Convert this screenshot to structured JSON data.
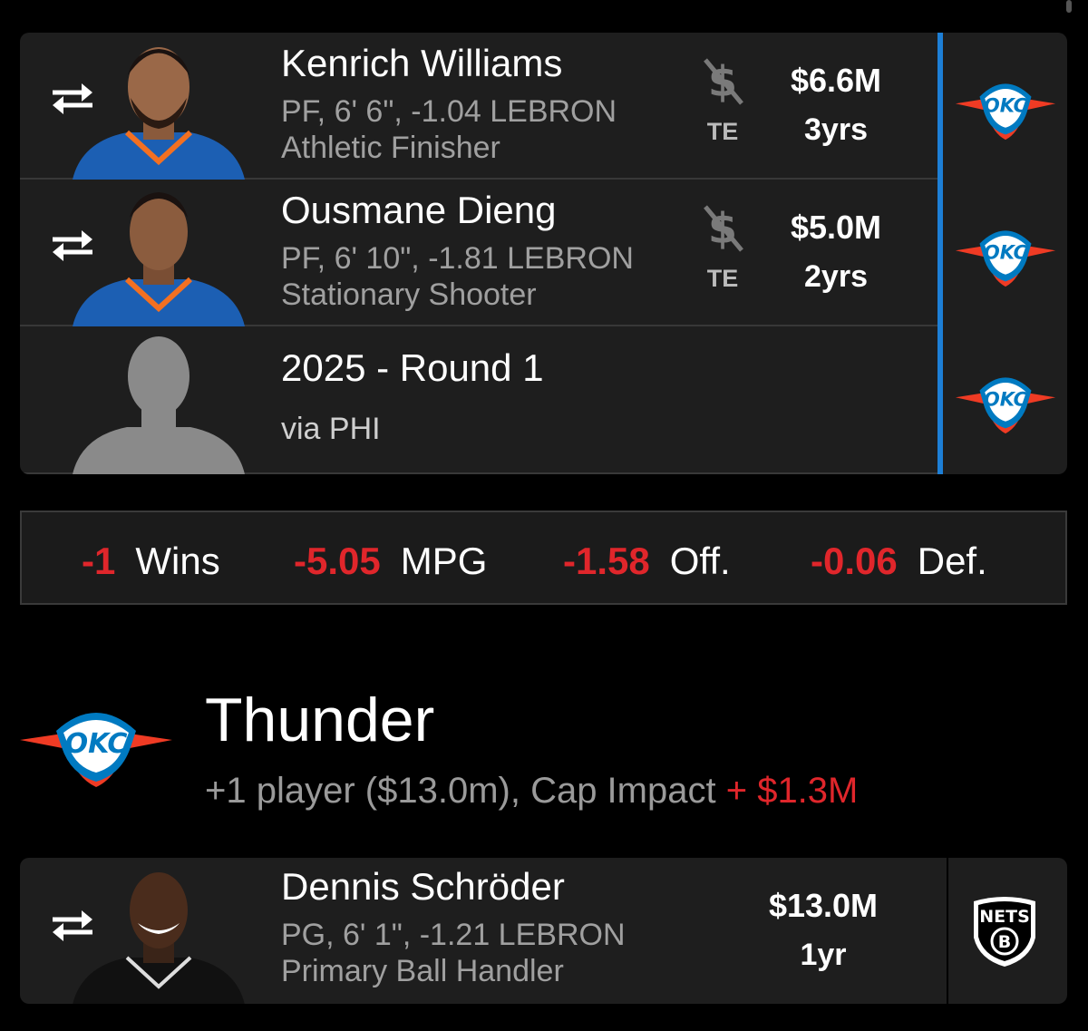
{
  "outgoing": [
    {
      "name": "Kenrich Williams",
      "details": "PF, 6' 6\", -1.04 LEBRON",
      "role": "Athletic Finisher",
      "te_label": "TE",
      "salary": "$6.6M",
      "years": "3yrs",
      "team_logo": "okc-thunder-logo"
    },
    {
      "name": "Ousmane Dieng",
      "details": "PF, 6' 10\", -1.81 LEBRON",
      "role": "Stationary Shooter",
      "te_label": "TE",
      "salary": "$5.0M",
      "years": "2yrs",
      "team_logo": "okc-thunder-logo"
    }
  ],
  "pick": {
    "title": "2025 - Round 1",
    "via": "via PHI",
    "team_logo": "okc-thunder-logo"
  },
  "impact": [
    {
      "value": "-1",
      "label": "Wins"
    },
    {
      "value": "-5.05",
      "label": "MPG"
    },
    {
      "value": "-1.58",
      "label": "Off."
    },
    {
      "value": "-0.06",
      "label": "Def."
    }
  ],
  "team": {
    "name": "Thunder",
    "summary": "+1 player ($13.0m), Cap Impact",
    "cap_impact": "+ $1.3M",
    "logo_text": "OKC"
  },
  "incoming": [
    {
      "name": "Dennis Schröder",
      "details": "PG, 6' 1\", -1.21 LEBRON",
      "role": "Primary Ball Handler",
      "salary": "$13.0M",
      "years": "1yr",
      "from_team_logo": "brooklyn-nets-logo",
      "logo_text": "NETS"
    }
  ],
  "colors": {
    "accent_blue": "#1d7fd6",
    "negative_red": "#e0262b",
    "card_bg": "#1e1e1e",
    "okc_orange": "#ef3b24",
    "okc_blue": "#007ac1"
  }
}
